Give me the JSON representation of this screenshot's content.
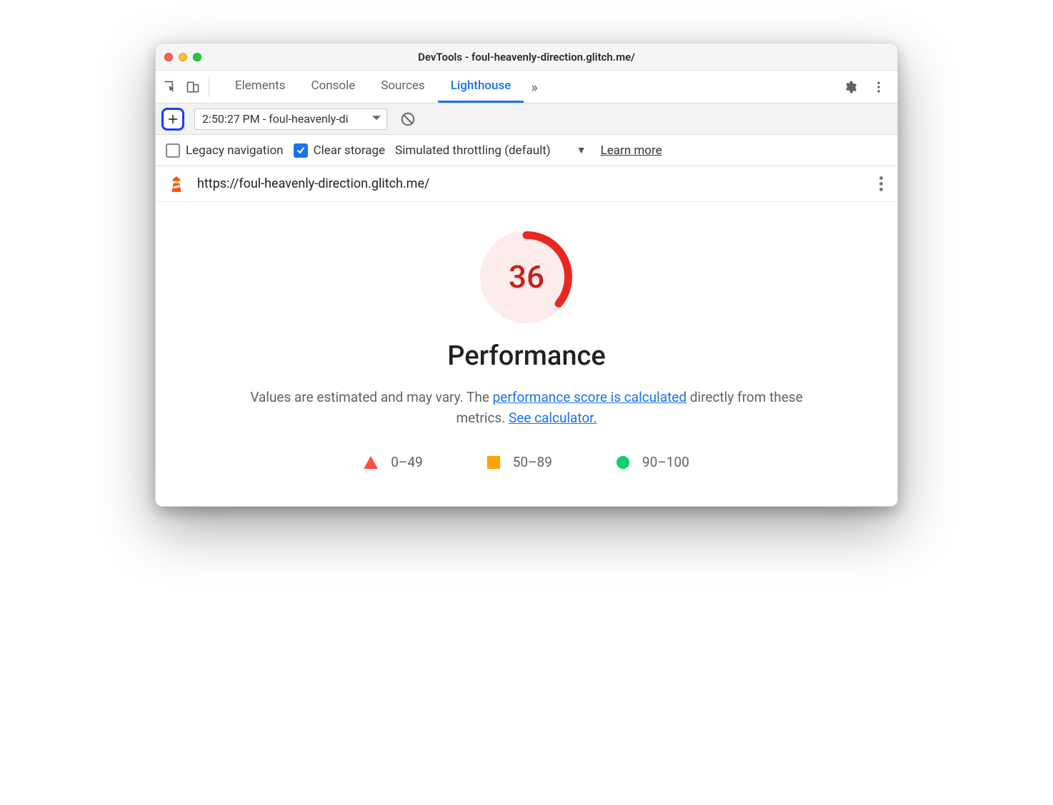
{
  "window": {
    "title": "DevTools - foul-heavenly-direction.glitch.me/"
  },
  "tabs": {
    "items": [
      "Elements",
      "Console",
      "Sources",
      "Lighthouse"
    ],
    "active": "Lighthouse",
    "overflow_glyph": "»"
  },
  "toolbar": {
    "report_label": "2:50:27 PM - foul-heavenly-di"
  },
  "options": {
    "legacy_label": "Legacy navigation",
    "legacy_checked": false,
    "clear_label": "Clear storage",
    "clear_checked": true,
    "throttling_label": "Simulated throttling (default)",
    "learn_more_label": "Learn more"
  },
  "url_row": {
    "url_text": "https://foul-heavenly-direction.glitch.me/"
  },
  "performance": {
    "score": "36",
    "title": "Performance",
    "desc_prefix": "Values are estimated and may vary. The ",
    "desc_link1": "performance score is calculated",
    "desc_mid": " directly from these metrics. ",
    "desc_link2": "See calculator.",
    "legend": {
      "low": "0–49",
      "mid": "50–89",
      "high": "90–100"
    }
  },
  "colors": {
    "fail": "#ff4e42",
    "avg": "#ffa400",
    "pass": "#0cce6b",
    "score_text": "#c5221f",
    "score_ring": "#e8271f"
  },
  "chart_data": {
    "type": "gauge",
    "title": "Performance",
    "value": 36,
    "min": 0,
    "max": 100,
    "bands": [
      {
        "label": "0–49",
        "min": 0,
        "max": 49,
        "color": "#ff4e42"
      },
      {
        "label": "50–89",
        "min": 50,
        "max": 89,
        "color": "#ffa400"
      },
      {
        "label": "90–100",
        "min": 90,
        "max": 100,
        "color": "#0cce6b"
      }
    ]
  }
}
